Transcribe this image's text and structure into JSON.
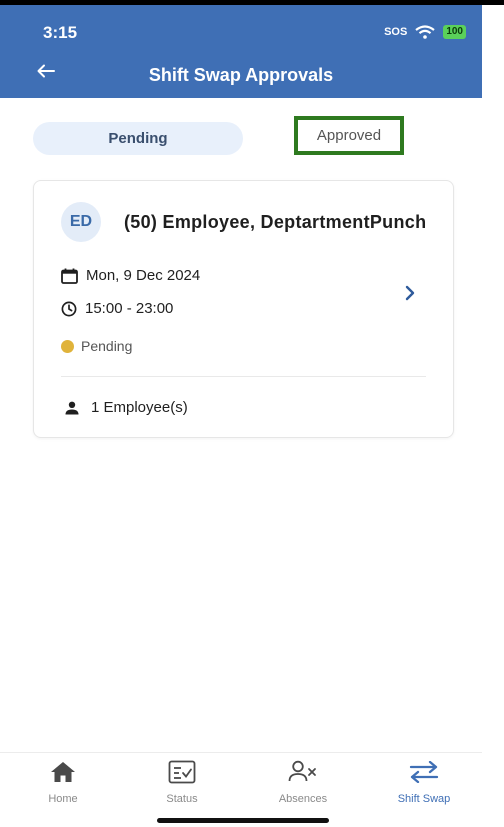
{
  "status_bar": {
    "time": "3:15",
    "sos": "SOS",
    "battery": "100"
  },
  "header": {
    "title": "Shift Swap Approvals"
  },
  "tabs": [
    {
      "label": "Pending",
      "selected": true
    },
    {
      "label": "Approved",
      "selected": false
    }
  ],
  "card": {
    "initials": "ED",
    "employee_name": "(50) Employee, DeptartmentPunch",
    "date": "Mon, 9 Dec 2024",
    "time_range": "15:00 - 23:00",
    "status": "Pending",
    "employee_count": "1 Employee(s)"
  },
  "bottom_nav": [
    {
      "label": "Home",
      "icon": "home-icon"
    },
    {
      "label": "Status",
      "icon": "status-icon"
    },
    {
      "label": "Absences",
      "icon": "absences-icon"
    },
    {
      "label": "Shift Swap",
      "icon": "shift-swap-icon",
      "active": true
    }
  ],
  "colors": {
    "header": "#3f6fb5",
    "pending_dot": "#e0b33a",
    "highlight_border": "#2e7a1f",
    "active_nav": "#3f6fb5"
  }
}
